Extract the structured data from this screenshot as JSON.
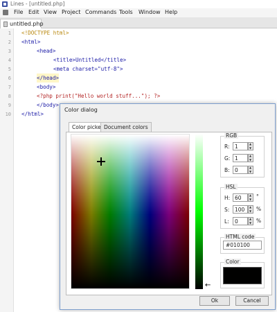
{
  "window": {
    "title": "Lines - [untitled.php]"
  },
  "menu": [
    "File",
    "Edit",
    "View",
    "Project",
    "Commands",
    "Tools",
    "Window",
    "Help"
  ],
  "tabs": [
    {
      "label": "untitled.php"
    }
  ],
  "editor": {
    "line_numbers": [
      "1",
      "2",
      "3",
      "4",
      "5",
      "6",
      "7",
      "8",
      "9",
      "10"
    ],
    "lines": [
      "<!DOCTYPE html>",
      "<html>",
      "<head>",
      "<title>Untitled</title>",
      "<meta charset=\"utf-8\">",
      "</head>",
      "<body>",
      "<?php print(\"Hello world stuff...\"); ?>",
      "</body>",
      "</html>"
    ]
  },
  "dialog": {
    "title": "Color dialog",
    "tabs": [
      "Color picker",
      "Document colors"
    ],
    "rgb": {
      "label": "RGB",
      "r_label": "R:",
      "r": "1",
      "g_label": "G:",
      "g": "1",
      "b_label": "B:",
      "b": "0"
    },
    "hsl": {
      "label": "HSL",
      "h_label": "H:",
      "h": "60",
      "h_unit": "°",
      "s_label": "S:",
      "s": "100",
      "s_unit": "%",
      "l_label": "L:",
      "l": "0",
      "l_unit": "%"
    },
    "html_code": {
      "label": "HTML code",
      "value": "#010100"
    },
    "color": {
      "label": "Color",
      "swatch": "#010100"
    },
    "buttons": {
      "ok": "Ok",
      "cancel": "Cancel"
    }
  }
}
